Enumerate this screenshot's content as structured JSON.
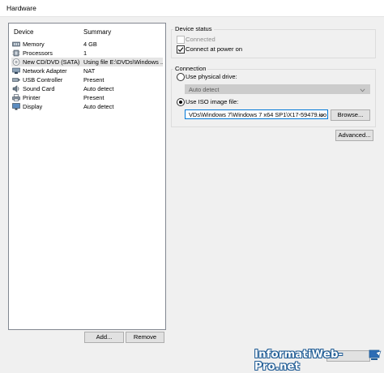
{
  "window": {
    "title": "Hardware"
  },
  "device_list": {
    "columns": [
      "Device",
      "Summary"
    ],
    "rows": [
      {
        "device": "Memory",
        "summary": "4 GB",
        "icon": "memory-icon",
        "selected": false
      },
      {
        "device": "Processors",
        "summary": "1",
        "icon": "processor-icon",
        "selected": false
      },
      {
        "device": "New CD/DVD (SATA)",
        "summary": "Using file E:\\DVDs\\Windows ...",
        "icon": "cd-dvd-icon",
        "selected": true
      },
      {
        "device": "Network Adapter",
        "summary": "NAT",
        "icon": "network-adapter-icon",
        "selected": false
      },
      {
        "device": "USB Controller",
        "summary": "Present",
        "icon": "usb-icon",
        "selected": false
      },
      {
        "device": "Sound Card",
        "summary": "Auto detect",
        "icon": "sound-card-icon",
        "selected": false
      },
      {
        "device": "Printer",
        "summary": "Present",
        "icon": "printer-icon",
        "selected": false
      },
      {
        "device": "Display",
        "summary": "Auto detect",
        "icon": "display-icon",
        "selected": false
      }
    ],
    "add_label": "Add...",
    "remove_label": "Remove"
  },
  "device_status": {
    "title": "Device status",
    "connected_label": "Connected",
    "connected_checked": false,
    "connect_power_on_label": "Connect at power on",
    "connect_power_on_checked": true
  },
  "connection": {
    "title": "Connection",
    "physical_label": "Use physical drive:",
    "physical_selected": false,
    "physical_value": "Auto detect",
    "iso_label": "Use ISO image file:",
    "iso_selected": true,
    "iso_value": "VDs\\Windows 7\\Windows 7 x64 SP1\\X17-59479.iso",
    "browse_label": "Browse...",
    "advanced_label": "Advanced..."
  },
  "watermark": {
    "text": "InformatiWeb-Pro.net"
  },
  "colors": {
    "accent": "#0078d7",
    "selection": "#e5e5e5",
    "watermark_outline": "#1d5a94"
  }
}
